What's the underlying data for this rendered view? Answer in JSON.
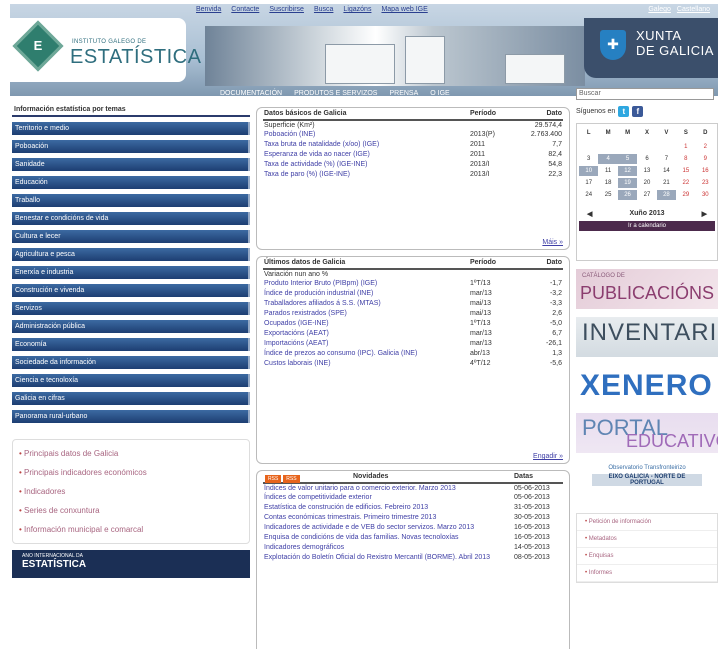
{
  "header": {
    "logo": {
      "mark": "E",
      "line1": "INSTITUTO GALEGO DE",
      "line2": "ESTATÍSTICA"
    },
    "top_links": [
      "Benvida",
      "Contacte",
      "Suscribirse",
      "Busca",
      "Ligazóns",
      "Mapa web IGE"
    ],
    "languages": [
      "Galego",
      "Castellano"
    ],
    "xunta": {
      "line1": "XUNTA",
      "line2": "DE GALICIA"
    },
    "search_placeholder": "Buscar",
    "nav": [
      "DOCUMENTACIÓN",
      "PRODUTOS E SERVIZOS",
      "PRENSA",
      "O IGE"
    ]
  },
  "left": {
    "title": "Información estatística por temas",
    "menu": [
      "Territorio e medio",
      "Poboación",
      "Sanidade",
      "Educación",
      "Traballo",
      "Benestar e condicións de vida",
      "Cultura e lecer",
      "Agricultura e pesca",
      "Enerxía e industria",
      "Construción e vivenda",
      "Servizos",
      "Administración pública",
      "Economía",
      "Sociedade da información",
      "Ciencia e tecnoloxía",
      "Galicia en cifras",
      "Panorama rural-urbano"
    ],
    "links": [
      "Principais datos de Galicia",
      "Principais indicadores económicos",
      "Indicadores",
      "Series de conxuntura",
      "Información municipal e comarcal"
    ],
    "banner": {
      "small": "ANO INTERNACIONAL DA",
      "big": "ESTATÍSTICA"
    }
  },
  "panel1": {
    "headers": [
      "Datos básicos de Galicia",
      "Período",
      "Dato"
    ],
    "rows": [
      {
        "label": "Superficie (Km²)",
        "period": "",
        "value": "29.574,4",
        "plain": true
      },
      {
        "label": "Poboación (INE)",
        "period": "2013(P)",
        "value": "2.763.400"
      },
      {
        "label": "Taxa bruta de natalidade (x/oo) (IGE)",
        "period": "2011",
        "value": "7,7"
      },
      {
        "label": "Esperanza de vida ao nacer (IGE)",
        "period": "2011",
        "value": "82,4"
      },
      {
        "label": "Taxa de actividade (%) (IGE-INE)",
        "period": "2013/I",
        "value": "54,8"
      },
      {
        "label": "Taxa de paro (%) (IGE-INE)",
        "period": "2013/I",
        "value": "22,3"
      }
    ],
    "more": "Máis »"
  },
  "panel2": {
    "headers": [
      "Últimos datos de Galicia",
      "Período",
      "Dato"
    ],
    "rows": [
      {
        "label": "Variación nun ano %",
        "period": "",
        "value": "",
        "plain": true
      },
      {
        "label": "Produto Interior Bruto (PIBpm) (IGE)",
        "period": "1ºT/13",
        "value": "-1,7"
      },
      {
        "label": "Índice de produción industrial (INE)",
        "period": "mar/13",
        "value": "-3,2"
      },
      {
        "label": "Traballadores afiliados á S.S. (MTAS)",
        "period": "mai/13",
        "value": "-3,3"
      },
      {
        "label": "Parados rexistrados (SPE)",
        "period": "mai/13",
        "value": "2,6"
      },
      {
        "label": "Ocupados (IGE-INE)",
        "period": "1ºT/13",
        "value": "-5,0"
      },
      {
        "label": "Exportacións (AEAT)",
        "period": "mar/13",
        "value": "6,7"
      },
      {
        "label": "Importacións (AEAT)",
        "period": "mar/13",
        "value": "-26,1"
      },
      {
        "label": "Índice de prezos ao consumo (IPC). Galicia (INE)",
        "period": "abr/13",
        "value": "1,3"
      },
      {
        "label": "Custos laborais (INE)",
        "period": "4ºT/12",
        "value": "-5,6"
      }
    ],
    "more": "Engadir »"
  },
  "panel3": {
    "tags": [
      "RSS",
      "RSS"
    ],
    "headers": [
      "Novidades",
      "Datas"
    ],
    "rows": [
      {
        "label": "Índices de valor unitario para o comercio exterior. Marzo 2013",
        "date": "05-06-2013"
      },
      {
        "label": "Índices de competitividade exterior",
        "date": "05-06-2013"
      },
      {
        "label": "Estatística de construción de edificios. Febreiro 2013",
        "date": "31-05-2013"
      },
      {
        "label": "Contas económicas trimestrais. Primeiro trimestre 2013",
        "date": "30-05-2013"
      },
      {
        "label": "Indicadores de actividade e de VEB do sector servizos. Marzo 2013",
        "date": "16-05-2013"
      },
      {
        "label": "Enquisa de condicións de vida das familias. Novas tecnoloxías",
        "date": "16-05-2013"
      },
      {
        "label": "Indicadores demográficos",
        "date": "14-05-2013"
      },
      {
        "label": "Explotación do Boletín Oficial do Rexistro Mercantil (BORME). Abril 2013",
        "date": "08-05-2013"
      }
    ]
  },
  "right": {
    "follow": "Síguenos en",
    "calendar": {
      "days": [
        "L",
        "M",
        "M",
        "X",
        "V",
        "S",
        "D"
      ],
      "cells": [
        "",
        "",
        "",
        "",
        "",
        "1",
        "2",
        "3",
        "4",
        "5",
        "6",
        "7",
        "8",
        "9",
        "10",
        "11",
        "12",
        "13",
        "14",
        "15",
        "16",
        "17",
        "18",
        "19",
        "20",
        "21",
        "22",
        "23",
        "24",
        "25",
        "26",
        "27",
        "28",
        "29",
        "30"
      ],
      "month": "Xuño 2013",
      "link": "Ir a calendario"
    },
    "banners": {
      "b1a": "CATÁLOGO DE",
      "b1b": "PUBLICACIÓNS",
      "b2": "INVENTARIO",
      "b3": "XENERO",
      "b4a": "PORTAL",
      "b4b": "EDUCATIVO",
      "b5a": "Observatorio Transfronteirizo",
      "b5b": "EIXO GALICIA - NORTE DE PORTUGAL"
    },
    "links": [
      "Petición de información",
      "Metadatos",
      "Enquisas",
      "Informes"
    ]
  }
}
